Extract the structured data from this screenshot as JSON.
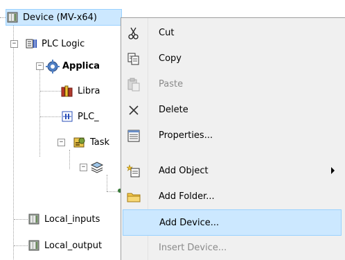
{
  "tree": {
    "device": {
      "label": "Device (MV-x64)",
      "icon": "device-icon"
    },
    "plc_logic": {
      "label": "PLC Logic",
      "icon": "plc-logic-icon"
    },
    "application": {
      "label": "Applica",
      "icon": "gear-icon"
    },
    "library": {
      "label": "Libra",
      "icon": "library-books-icon"
    },
    "plc_prg": {
      "label": "PLC_",
      "icon": "pou-icon"
    },
    "task": {
      "label": "Task",
      "icon": "task-config-icon"
    },
    "local_inputs": {
      "label": "Local_inputs",
      "icon": "device-icon"
    },
    "local_outputs": {
      "label": "Local_output",
      "icon": "device-icon"
    }
  },
  "context_menu": {
    "items": [
      {
        "label": "Cut",
        "icon": "scissors-icon",
        "state": "normal"
      },
      {
        "label": "Copy",
        "icon": "copy-icon",
        "state": "normal"
      },
      {
        "label": "Paste",
        "icon": "paste-icon",
        "state": "disabled"
      },
      {
        "label": "Delete",
        "icon": "delete-x-icon",
        "state": "normal"
      },
      {
        "label": "Properties...",
        "icon": "properties-icon",
        "state": "normal"
      },
      {
        "label": "Add Object",
        "icon": "add-object-icon",
        "state": "normal",
        "submenu": true
      },
      {
        "label": "Add Folder...",
        "icon": "folder-icon",
        "state": "normal"
      },
      {
        "label": "Add Device...",
        "icon": "",
        "state": "highlighted"
      },
      {
        "label": "Insert Device...",
        "icon": "",
        "state": "disabled"
      }
    ]
  },
  "colors": {
    "selection": "#cce8ff",
    "selection_border": "#99d1ff",
    "menu_bg": "#f0f0f0",
    "disabled_text": "#8a8a8a"
  }
}
